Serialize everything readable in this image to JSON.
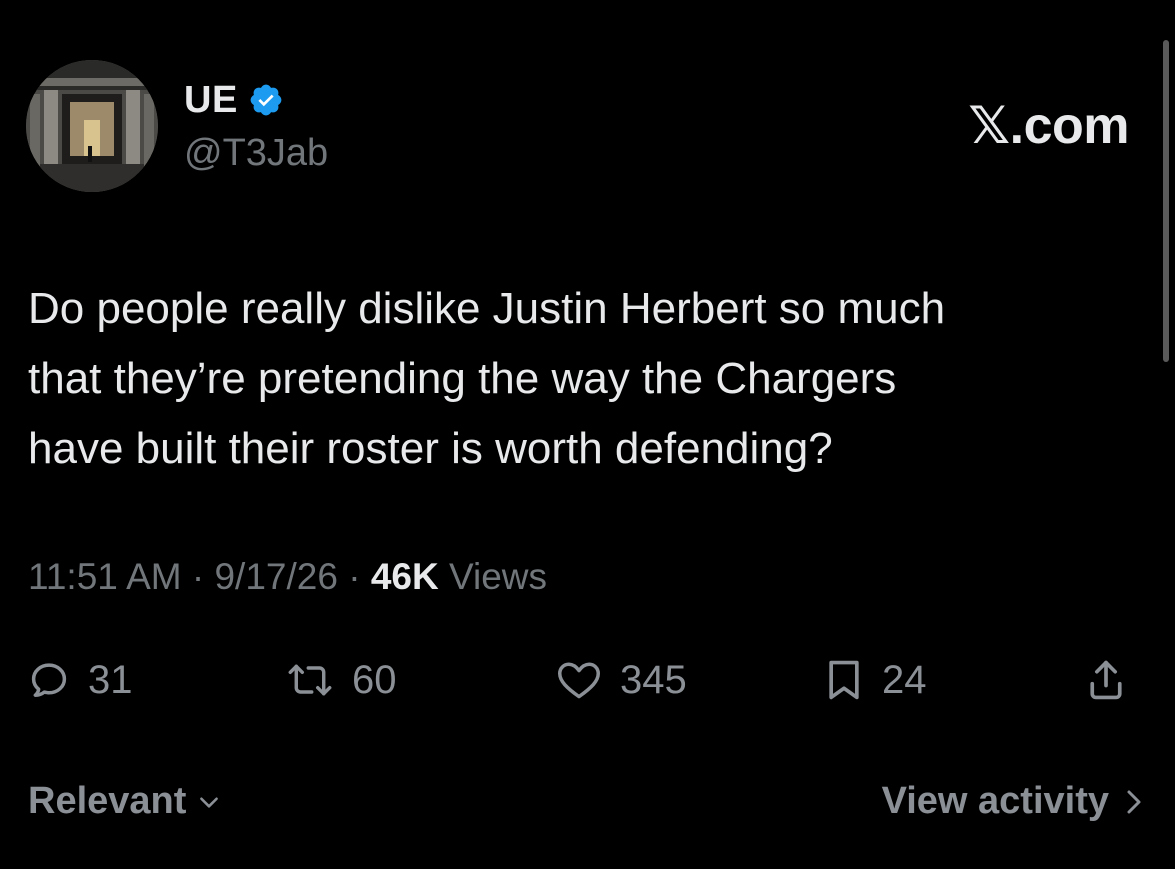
{
  "author": {
    "display_name": "UE",
    "handle": "@T3Jab"
  },
  "brand": "𝕏.com",
  "tweet": {
    "text": "Do people really dislike Justin Herbert so much\nthat they’re pretending the way the Chargers\nhave built their roster is worth defending?",
    "time": "11:51 AM",
    "date": "9/17/26",
    "views_count": "46K",
    "views_label": "Views"
  },
  "actions": {
    "replies": "31",
    "reposts": "60",
    "likes": "345",
    "bookmarks": "24"
  },
  "footer": {
    "sort_label": "Relevant",
    "activity_label": "View activity"
  },
  "icons": {
    "verified": "verified-badge-icon",
    "reply": "reply-icon",
    "repost": "repost-icon",
    "like": "heart-icon",
    "bookmark": "bookmark-icon",
    "share": "share-icon"
  },
  "colors": {
    "background": "#000000",
    "text_primary": "#e7e9ea",
    "text_secondary": "#71767b",
    "verified": "#1d9bf0"
  }
}
